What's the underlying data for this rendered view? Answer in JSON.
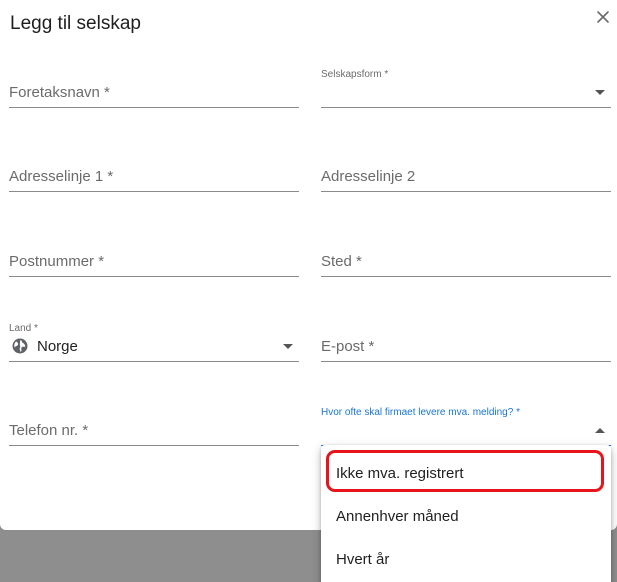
{
  "dialog": {
    "title": "Legg til selskap",
    "close_icon": "close-icon"
  },
  "fields": {
    "company_name": {
      "label": "Foretaksnavn *"
    },
    "company_form": {
      "label": "Selskapsform *",
      "value": ""
    },
    "address1": {
      "label": "Adresselinje 1 *"
    },
    "address2": {
      "label": "Adresselinje 2"
    },
    "postal_code": {
      "label": "Postnummer *"
    },
    "city": {
      "label": "Sted *"
    },
    "country": {
      "label": "Land *",
      "value": "Norge",
      "icon": "globe-icon"
    },
    "email": {
      "label": "E-post *"
    },
    "phone": {
      "label": "Telefon nr. *"
    },
    "vat_frequency": {
      "label": "Hvor ofte skal firmaet levere mva. melding? *",
      "value": ""
    }
  },
  "menu": {
    "items": [
      {
        "label": "Ikke mva. registrert"
      },
      {
        "label": "Annenhver måned"
      },
      {
        "label": "Hvert år"
      }
    ]
  },
  "colors": {
    "accent": "#1976d2",
    "highlight": "#e8141b"
  }
}
